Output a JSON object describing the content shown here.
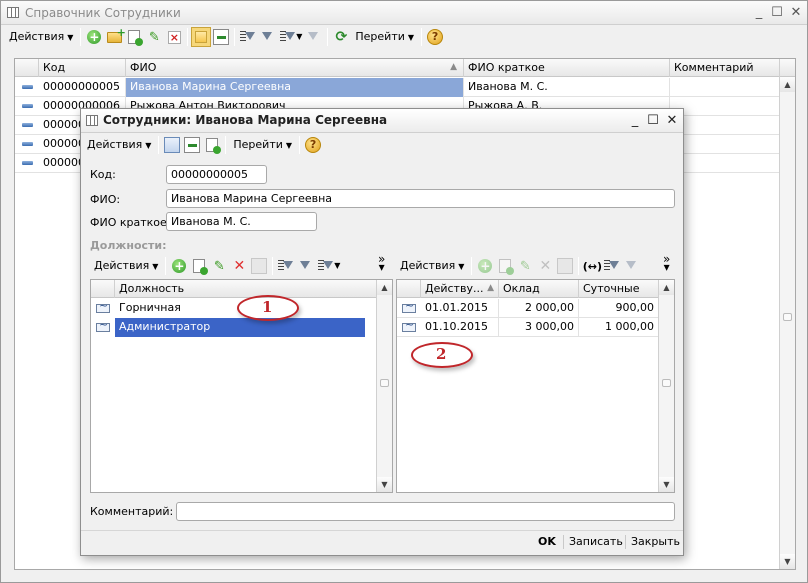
{
  "outer": {
    "title": "Справочник Сотрудники",
    "toolbar": {
      "actions": "Действия",
      "goto": "Перейти"
    },
    "columns": [
      "Код",
      "ФИО",
      "ФИО краткое",
      "Комментарий"
    ],
    "rows": [
      {
        "code": "00000000005",
        "fio": "Иванова Марина Сергеевна",
        "short": "Иванова М. С.",
        "comment": ""
      },
      {
        "code": "00000000006",
        "fio": "Рыжова Антон Викторович",
        "short": "Рыжова А. В.",
        "comment": ""
      },
      {
        "code": "000000",
        "fio": "",
        "short": "",
        "comment": ""
      },
      {
        "code": "000000",
        "fio": "",
        "short": "",
        "comment": ""
      },
      {
        "code": "000000",
        "fio": "",
        "short": "",
        "comment": ""
      }
    ]
  },
  "dialog": {
    "title": "Сотрудники: Иванова Марина Сергеевна",
    "toolbar": {
      "actions": "Действия",
      "goto": "Перейти"
    },
    "labels": {
      "code": "Код:",
      "fio": "ФИО:",
      "short": "ФИО краткое:",
      "positions": "Должности:",
      "comment": "Комментарий:"
    },
    "values": {
      "code": "00000000005",
      "fio": "Иванова Марина Сергеевна",
      "short": "Иванова М. С.",
      "comment": ""
    },
    "left_table": {
      "actions": "Действия",
      "column": "Должность",
      "rows": [
        "Горничная",
        "Администратор"
      ]
    },
    "right_table": {
      "actions": "Действия",
      "columns": [
        "Действу...",
        "Оклад",
        "Суточные"
      ],
      "rows": [
        {
          "date": "01.01.2015",
          "salary": "2 000,00",
          "daily": "900,00"
        },
        {
          "date": "01.10.2015",
          "salary": "3 000,00",
          "daily": "1 000,00"
        }
      ]
    },
    "buttons": {
      "ok": "OK",
      "save": "Записать",
      "close": "Закрыть"
    }
  },
  "annotations": [
    "1",
    "2"
  ],
  "colors": {
    "selection": "#3b64c7",
    "annotation": "#c0262a"
  }
}
